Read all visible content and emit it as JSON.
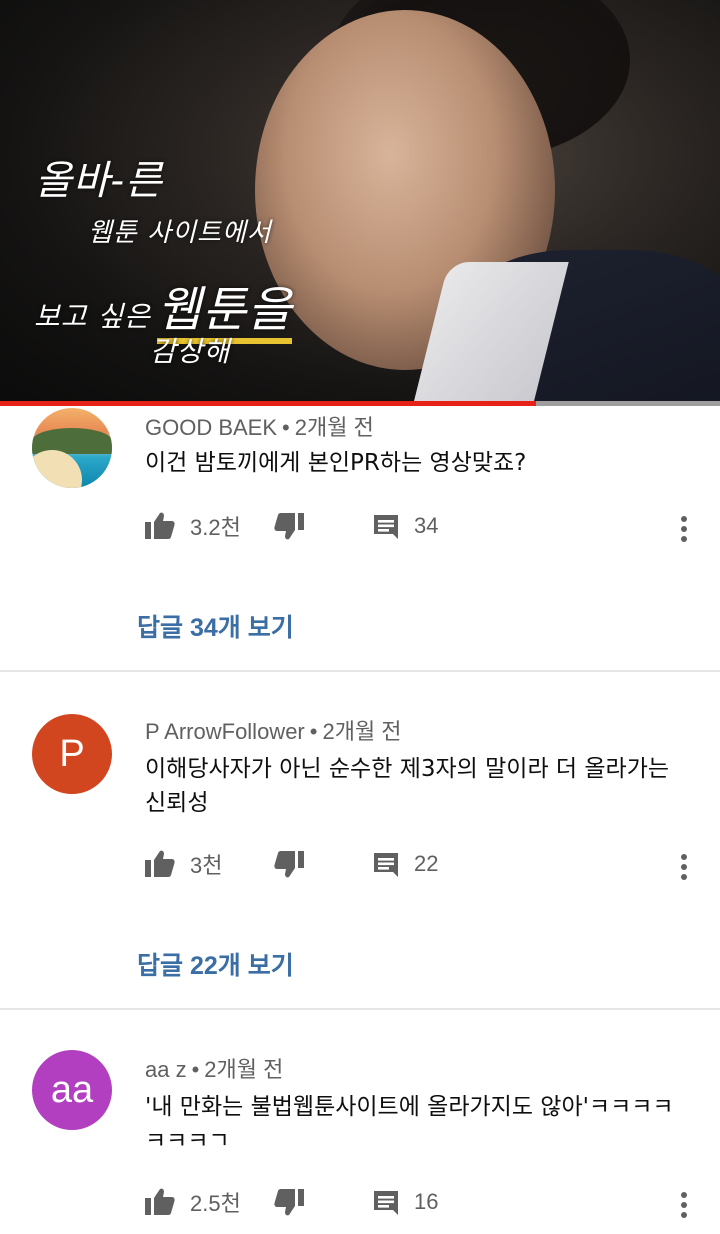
{
  "video": {
    "overlay_line1": "올바-른",
    "overlay_line2": "웹툰 사이트에서",
    "overlay_line3_small": "보고 싶은",
    "overlay_line3_big": "웹툰을",
    "overlay_line4": "감상해",
    "progress_fraction": 0.745,
    "progress_color": "#e62117"
  },
  "comments": [
    {
      "author": "GOOD BAEK",
      "time": "2개월 전",
      "avatar": {
        "type": "photo",
        "icon": "beach-photo"
      },
      "text": "이건 밤토끼에게 본인PR하는 영상맞죠?",
      "likes": "3.2천",
      "reply_count": "34",
      "replies_label_prefix": "답글 ",
      "replies_label_count": "34개",
      "replies_label_suffix": " 보기"
    },
    {
      "author": "P ArrowFollower",
      "time": "2개월 전",
      "avatar": {
        "type": "letter",
        "letter": "P",
        "color": "#d2461f"
      },
      "text": "이해당사자가 아닌 순수한 제3자의 말이라 더 올라가는 신뢰성",
      "likes": "3천",
      "reply_count": "22",
      "replies_label_prefix": "답글 ",
      "replies_label_count": "22개",
      "replies_label_suffix": " 보기"
    },
    {
      "author": "aa z",
      "time": "2개월 전",
      "avatar": {
        "type": "letter",
        "letter": "aa",
        "color": "#b23fc0"
      },
      "text": "'내 만화는 불법웹툰사이트에 올라가지도 않아'ㅋㅋㅋㅋㅋㅋㅋㄱ",
      "likes": "2.5천",
      "reply_count": "16"
    }
  ],
  "separator": "•",
  "colors": {
    "meta_gray": "#606060",
    "reply_link_blue": "#3a6ea5",
    "divider": "#e5e5e5"
  }
}
